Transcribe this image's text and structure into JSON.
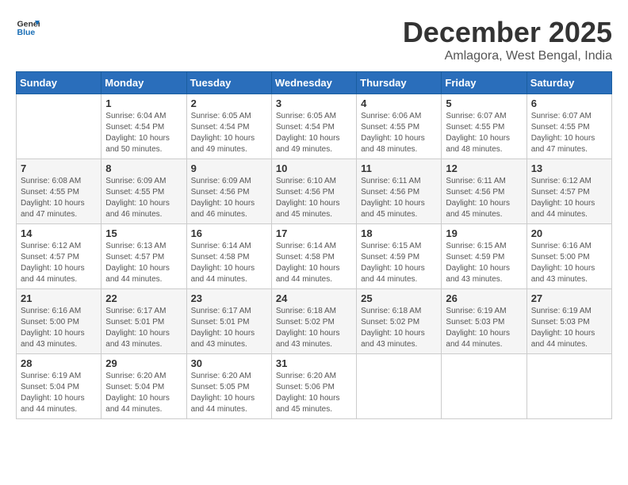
{
  "header": {
    "logo_general": "General",
    "logo_blue": "Blue",
    "month": "December 2025",
    "location": "Amlagora, West Bengal, India"
  },
  "days_of_week": [
    "Sunday",
    "Monday",
    "Tuesday",
    "Wednesday",
    "Thursday",
    "Friday",
    "Saturday"
  ],
  "weeks": [
    [
      {
        "day": "",
        "info": ""
      },
      {
        "day": "1",
        "info": "Sunrise: 6:04 AM\nSunset: 4:54 PM\nDaylight: 10 hours\nand 50 minutes."
      },
      {
        "day": "2",
        "info": "Sunrise: 6:05 AM\nSunset: 4:54 PM\nDaylight: 10 hours\nand 49 minutes."
      },
      {
        "day": "3",
        "info": "Sunrise: 6:05 AM\nSunset: 4:54 PM\nDaylight: 10 hours\nand 49 minutes."
      },
      {
        "day": "4",
        "info": "Sunrise: 6:06 AM\nSunset: 4:55 PM\nDaylight: 10 hours\nand 48 minutes."
      },
      {
        "day": "5",
        "info": "Sunrise: 6:07 AM\nSunset: 4:55 PM\nDaylight: 10 hours\nand 48 minutes."
      },
      {
        "day": "6",
        "info": "Sunrise: 6:07 AM\nSunset: 4:55 PM\nDaylight: 10 hours\nand 47 minutes."
      }
    ],
    [
      {
        "day": "7",
        "info": "Sunrise: 6:08 AM\nSunset: 4:55 PM\nDaylight: 10 hours\nand 47 minutes."
      },
      {
        "day": "8",
        "info": "Sunrise: 6:09 AM\nSunset: 4:55 PM\nDaylight: 10 hours\nand 46 minutes."
      },
      {
        "day": "9",
        "info": "Sunrise: 6:09 AM\nSunset: 4:56 PM\nDaylight: 10 hours\nand 46 minutes."
      },
      {
        "day": "10",
        "info": "Sunrise: 6:10 AM\nSunset: 4:56 PM\nDaylight: 10 hours\nand 45 minutes."
      },
      {
        "day": "11",
        "info": "Sunrise: 6:11 AM\nSunset: 4:56 PM\nDaylight: 10 hours\nand 45 minutes."
      },
      {
        "day": "12",
        "info": "Sunrise: 6:11 AM\nSunset: 4:56 PM\nDaylight: 10 hours\nand 45 minutes."
      },
      {
        "day": "13",
        "info": "Sunrise: 6:12 AM\nSunset: 4:57 PM\nDaylight: 10 hours\nand 44 minutes."
      }
    ],
    [
      {
        "day": "14",
        "info": "Sunrise: 6:12 AM\nSunset: 4:57 PM\nDaylight: 10 hours\nand 44 minutes."
      },
      {
        "day": "15",
        "info": "Sunrise: 6:13 AM\nSunset: 4:57 PM\nDaylight: 10 hours\nand 44 minutes."
      },
      {
        "day": "16",
        "info": "Sunrise: 6:14 AM\nSunset: 4:58 PM\nDaylight: 10 hours\nand 44 minutes."
      },
      {
        "day": "17",
        "info": "Sunrise: 6:14 AM\nSunset: 4:58 PM\nDaylight: 10 hours\nand 44 minutes."
      },
      {
        "day": "18",
        "info": "Sunrise: 6:15 AM\nSunset: 4:59 PM\nDaylight: 10 hours\nand 44 minutes."
      },
      {
        "day": "19",
        "info": "Sunrise: 6:15 AM\nSunset: 4:59 PM\nDaylight: 10 hours\nand 43 minutes."
      },
      {
        "day": "20",
        "info": "Sunrise: 6:16 AM\nSunset: 5:00 PM\nDaylight: 10 hours\nand 43 minutes."
      }
    ],
    [
      {
        "day": "21",
        "info": "Sunrise: 6:16 AM\nSunset: 5:00 PM\nDaylight: 10 hours\nand 43 minutes."
      },
      {
        "day": "22",
        "info": "Sunrise: 6:17 AM\nSunset: 5:01 PM\nDaylight: 10 hours\nand 43 minutes."
      },
      {
        "day": "23",
        "info": "Sunrise: 6:17 AM\nSunset: 5:01 PM\nDaylight: 10 hours\nand 43 minutes."
      },
      {
        "day": "24",
        "info": "Sunrise: 6:18 AM\nSunset: 5:02 PM\nDaylight: 10 hours\nand 43 minutes."
      },
      {
        "day": "25",
        "info": "Sunrise: 6:18 AM\nSunset: 5:02 PM\nDaylight: 10 hours\nand 43 minutes."
      },
      {
        "day": "26",
        "info": "Sunrise: 6:19 AM\nSunset: 5:03 PM\nDaylight: 10 hours\nand 44 minutes."
      },
      {
        "day": "27",
        "info": "Sunrise: 6:19 AM\nSunset: 5:03 PM\nDaylight: 10 hours\nand 44 minutes."
      }
    ],
    [
      {
        "day": "28",
        "info": "Sunrise: 6:19 AM\nSunset: 5:04 PM\nDaylight: 10 hours\nand 44 minutes."
      },
      {
        "day": "29",
        "info": "Sunrise: 6:20 AM\nSunset: 5:04 PM\nDaylight: 10 hours\nand 44 minutes."
      },
      {
        "day": "30",
        "info": "Sunrise: 6:20 AM\nSunset: 5:05 PM\nDaylight: 10 hours\nand 44 minutes."
      },
      {
        "day": "31",
        "info": "Sunrise: 6:20 AM\nSunset: 5:06 PM\nDaylight: 10 hours\nand 45 minutes."
      },
      {
        "day": "",
        "info": ""
      },
      {
        "day": "",
        "info": ""
      },
      {
        "day": "",
        "info": ""
      }
    ]
  ]
}
